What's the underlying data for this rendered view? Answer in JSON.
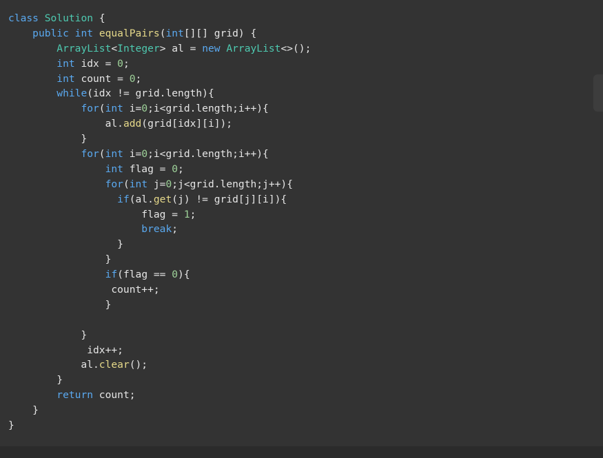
{
  "code": {
    "language": "java",
    "lines": [
      [
        {
          "t": "class",
          "c": "kw"
        },
        {
          "t": " ",
          "c": "pl"
        },
        {
          "t": "Solution",
          "c": "ty"
        },
        {
          "t": " {",
          "c": "pl"
        }
      ],
      [
        {
          "t": "    ",
          "c": "pl"
        },
        {
          "t": "public",
          "c": "kw"
        },
        {
          "t": " ",
          "c": "pl"
        },
        {
          "t": "int",
          "c": "kw"
        },
        {
          "t": " ",
          "c": "pl"
        },
        {
          "t": "equalPairs",
          "c": "fn"
        },
        {
          "t": "(",
          "c": "pl"
        },
        {
          "t": "int",
          "c": "kw"
        },
        {
          "t": "[][] grid) {",
          "c": "pl"
        }
      ],
      [
        {
          "t": "        ",
          "c": "pl"
        },
        {
          "t": "ArrayList",
          "c": "ty"
        },
        {
          "t": "<",
          "c": "pl"
        },
        {
          "t": "Integer",
          "c": "ty"
        },
        {
          "t": "> al = ",
          "c": "pl"
        },
        {
          "t": "new",
          "c": "kw"
        },
        {
          "t": " ",
          "c": "pl"
        },
        {
          "t": "ArrayList",
          "c": "ty"
        },
        {
          "t": "<>();",
          "c": "pl"
        }
      ],
      [
        {
          "t": "        ",
          "c": "pl"
        },
        {
          "t": "int",
          "c": "kw"
        },
        {
          "t": " idx = ",
          "c": "pl"
        },
        {
          "t": "0",
          "c": "nm"
        },
        {
          "t": ";",
          "c": "pl"
        }
      ],
      [
        {
          "t": "        ",
          "c": "pl"
        },
        {
          "t": "int",
          "c": "kw"
        },
        {
          "t": " count = ",
          "c": "pl"
        },
        {
          "t": "0",
          "c": "nm"
        },
        {
          "t": ";",
          "c": "pl"
        }
      ],
      [
        {
          "t": "        ",
          "c": "pl"
        },
        {
          "t": "while",
          "c": "kw"
        },
        {
          "t": "(idx != grid.length){",
          "c": "pl"
        }
      ],
      [
        {
          "t": "            ",
          "c": "pl"
        },
        {
          "t": "for",
          "c": "kw"
        },
        {
          "t": "(",
          "c": "pl"
        },
        {
          "t": "int",
          "c": "kw"
        },
        {
          "t": " i=",
          "c": "pl"
        },
        {
          "t": "0",
          "c": "nm"
        },
        {
          "t": ";i<grid.length;i++){",
          "c": "pl"
        }
      ],
      [
        {
          "t": "                al.",
          "c": "pl"
        },
        {
          "t": "add",
          "c": "fn"
        },
        {
          "t": "(grid[idx][i]);",
          "c": "pl"
        }
      ],
      [
        {
          "t": "            }",
          "c": "pl"
        }
      ],
      [
        {
          "t": "            ",
          "c": "pl"
        },
        {
          "t": "for",
          "c": "kw"
        },
        {
          "t": "(",
          "c": "pl"
        },
        {
          "t": "int",
          "c": "kw"
        },
        {
          "t": " i=",
          "c": "pl"
        },
        {
          "t": "0",
          "c": "nm"
        },
        {
          "t": ";i<grid.length;i++){",
          "c": "pl"
        }
      ],
      [
        {
          "t": "                ",
          "c": "pl"
        },
        {
          "t": "int",
          "c": "kw"
        },
        {
          "t": " flag = ",
          "c": "pl"
        },
        {
          "t": "0",
          "c": "nm"
        },
        {
          "t": ";",
          "c": "pl"
        }
      ],
      [
        {
          "t": "                ",
          "c": "pl"
        },
        {
          "t": "for",
          "c": "kw"
        },
        {
          "t": "(",
          "c": "pl"
        },
        {
          "t": "int",
          "c": "kw"
        },
        {
          "t": " j=",
          "c": "pl"
        },
        {
          "t": "0",
          "c": "nm"
        },
        {
          "t": ";j<grid.length;j++){",
          "c": "pl"
        }
      ],
      [
        {
          "t": "                  ",
          "c": "pl"
        },
        {
          "t": "if",
          "c": "kw"
        },
        {
          "t": "(al.",
          "c": "pl"
        },
        {
          "t": "get",
          "c": "fn"
        },
        {
          "t": "(j) != grid[j][i]){",
          "c": "pl"
        }
      ],
      [
        {
          "t": "                      flag = ",
          "c": "pl"
        },
        {
          "t": "1",
          "c": "nm"
        },
        {
          "t": ";",
          "c": "pl"
        }
      ],
      [
        {
          "t": "                      ",
          "c": "pl"
        },
        {
          "t": "break",
          "c": "kw"
        },
        {
          "t": ";",
          "c": "pl"
        }
      ],
      [
        {
          "t": "                  }",
          "c": "pl"
        }
      ],
      [
        {
          "t": "                }",
          "c": "pl"
        }
      ],
      [
        {
          "t": "                ",
          "c": "pl"
        },
        {
          "t": "if",
          "c": "kw"
        },
        {
          "t": "(flag == ",
          "c": "pl"
        },
        {
          "t": "0",
          "c": "nm"
        },
        {
          "t": "){",
          "c": "pl"
        }
      ],
      [
        {
          "t": "                 count++;",
          "c": "pl"
        }
      ],
      [
        {
          "t": "                }",
          "c": "pl"
        }
      ],
      [
        {
          "t": "",
          "c": "pl"
        }
      ],
      [
        {
          "t": "            }",
          "c": "pl"
        }
      ],
      [
        {
          "t": "             idx++;",
          "c": "pl"
        }
      ],
      [
        {
          "t": "            al.",
          "c": "pl"
        },
        {
          "t": "clear",
          "c": "fn"
        },
        {
          "t": "();",
          "c": "pl"
        }
      ],
      [
        {
          "t": "        }",
          "c": "pl"
        }
      ],
      [
        {
          "t": "        ",
          "c": "pl"
        },
        {
          "t": "return",
          "c": "kw"
        },
        {
          "t": " count;",
          "c": "pl"
        }
      ],
      [
        {
          "t": "    }",
          "c": "pl"
        }
      ],
      [
        {
          "t": "}",
          "c": "pl"
        }
      ]
    ]
  },
  "colors": {
    "background": "#333333",
    "keyword": "#5aa9f0",
    "type": "#4ec9b0",
    "function": "#e6d98a",
    "number": "#9fd39a",
    "plain": "#e6e6e6"
  }
}
